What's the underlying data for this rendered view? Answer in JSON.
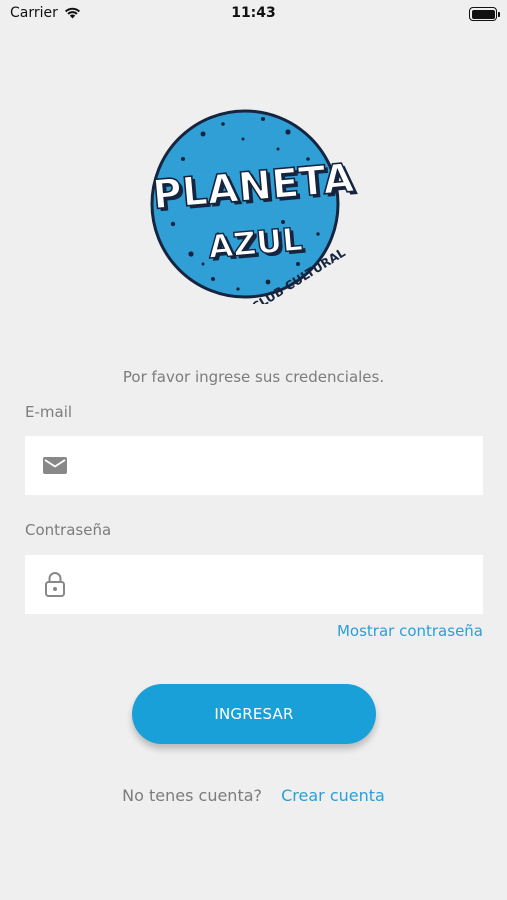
{
  "status_bar": {
    "carrier": "Carrier",
    "time": "11:43"
  },
  "logo": {
    "line1": "PLANETA",
    "line2": "AZUL",
    "tagline": "CLUB CULTURAL"
  },
  "instructions": "Por favor ingrese sus credenciales.",
  "email": {
    "label": "E-mail",
    "value": "",
    "icon": "envelope-icon"
  },
  "password": {
    "label": "Contraseña",
    "value": "",
    "icon": "lock-icon",
    "show_label": "Mostrar contraseña"
  },
  "login_button": "INGRESAR",
  "signup": {
    "question": "No tenes cuenta?",
    "link": "Crear cuenta"
  },
  "colors": {
    "background": "#efefef",
    "accent": "#1aa0d8",
    "link": "#2a9fd8",
    "logo_blue": "#2f9fd6",
    "logo_dark": "#15243f"
  }
}
